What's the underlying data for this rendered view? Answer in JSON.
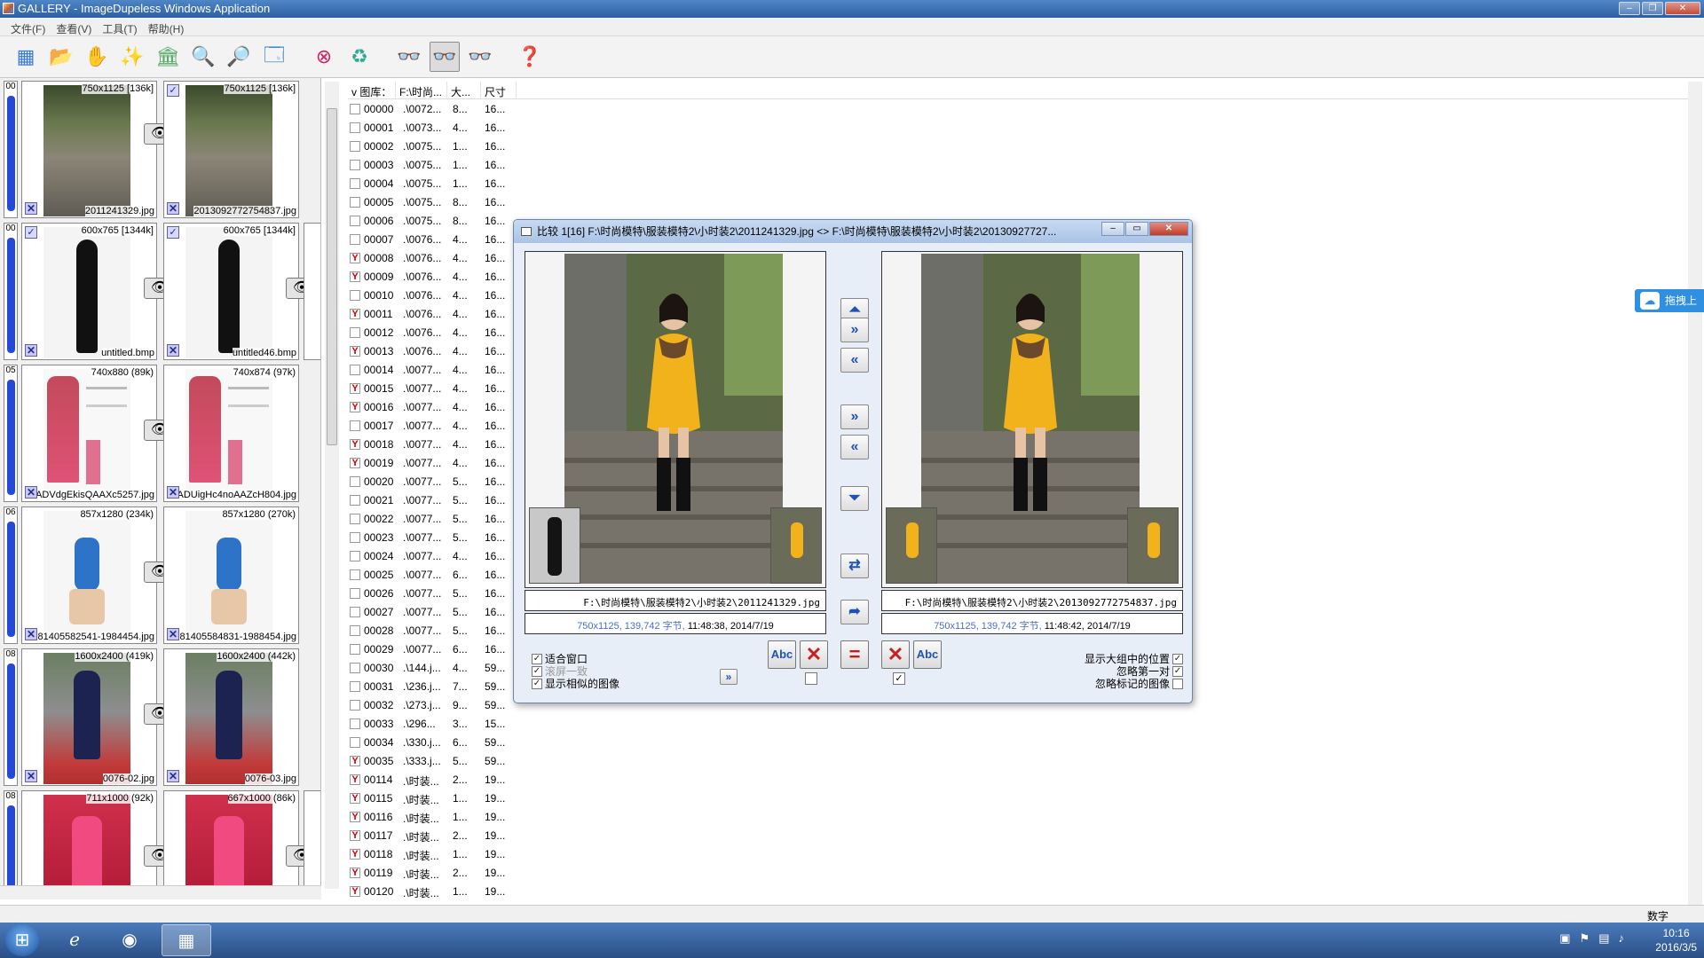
{
  "window": {
    "title": "GALLERY - ImageDupeless Windows Application"
  },
  "menu": [
    "文件(F)",
    "查看(V)",
    "工具(T)",
    "帮助(H)"
  ],
  "groups": [
    {
      "num": "00",
      "a": {
        "dim": "750x1125 [136k]",
        "name": "2011241329.jpg"
      },
      "b": {
        "dim": "750x1125 [136k]",
        "name": "2013092772754837.jpg"
      }
    },
    {
      "num": "00",
      "a": {
        "dim": "600x765 [1344k]",
        "name": "untitled.bmp"
      },
      "b": {
        "dim": "600x765 [1344k]",
        "name": "untitled46.bmp"
      }
    },
    {
      "num": "05",
      "a": {
        "dim": "740x880 (89k)",
        "name": "xADVdgEkisQAAXc5257.jpg"
      },
      "b": {
        "dim": "740x874 (97k)",
        "name": "ADUigHc4noAAZcH804.jpg"
      }
    },
    {
      "num": "06",
      "a": {
        "dim": "857x1280 (234k)",
        "name": "7181405582541-1984454.jpg"
      },
      "b": {
        "dim": "857x1280 (270k)",
        "name": "181405584831-1988454.jpg"
      }
    },
    {
      "num": "08",
      "a": {
        "dim": "1600x2400 (419k)",
        "name": "0076-02.jpg"
      },
      "b": {
        "dim": "1600x2400 (442k)",
        "name": "0076-03.jpg"
      }
    },
    {
      "num": "08",
      "a": {
        "dim": "711x1000 (92k)",
        "name": ""
      },
      "b": {
        "dim": "667x1000 (86k)",
        "name": ""
      }
    }
  ],
  "list": {
    "headers": [
      "图库：",
      "F:\\时尚...",
      "大...",
      "尺寸"
    ],
    "rows": [
      {
        "id": "00000",
        "path": ".\\0072...",
        "size": "8...",
        "dim": "16...",
        "checked": false
      },
      {
        "id": "00001",
        "path": ".\\0073...",
        "size": "4...",
        "dim": "16...",
        "checked": false
      },
      {
        "id": "00002",
        "path": ".\\0075...",
        "size": "1...",
        "dim": "16...",
        "checked": false
      },
      {
        "id": "00003",
        "path": ".\\0075...",
        "size": "1...",
        "dim": "16...",
        "checked": false
      },
      {
        "id": "00004",
        "path": ".\\0075...",
        "size": "1...",
        "dim": "16...",
        "checked": false
      },
      {
        "id": "00005",
        "path": ".\\0075...",
        "size": "8...",
        "dim": "16...",
        "checked": false
      },
      {
        "id": "00006",
        "path": ".\\0075...",
        "size": "8...",
        "dim": "16...",
        "checked": false
      },
      {
        "id": "00007",
        "path": ".\\0076...",
        "size": "4...",
        "dim": "16...",
        "checked": false
      },
      {
        "id": "00008",
        "path": ".\\0076...",
        "size": "4...",
        "dim": "16...",
        "checked": true
      },
      {
        "id": "00009",
        "path": ".\\0076...",
        "size": "4...",
        "dim": "16...",
        "checked": true
      },
      {
        "id": "00010",
        "path": ".\\0076...",
        "size": "4...",
        "dim": "16...",
        "checked": false
      },
      {
        "id": "00011",
        "path": ".\\0076...",
        "size": "4...",
        "dim": "16...",
        "checked": true
      },
      {
        "id": "00012",
        "path": ".\\0076...",
        "size": "4...",
        "dim": "16...",
        "checked": false
      },
      {
        "id": "00013",
        "path": ".\\0076...",
        "size": "4...",
        "dim": "16...",
        "checked": true
      },
      {
        "id": "00014",
        "path": ".\\0077...",
        "size": "4...",
        "dim": "16...",
        "checked": false
      },
      {
        "id": "00015",
        "path": ".\\0077...",
        "size": "4...",
        "dim": "16...",
        "checked": true
      },
      {
        "id": "00016",
        "path": ".\\0077...",
        "size": "4...",
        "dim": "16...",
        "checked": true
      },
      {
        "id": "00017",
        "path": ".\\0077...",
        "size": "4...",
        "dim": "16...",
        "checked": false
      },
      {
        "id": "00018",
        "path": ".\\0077...",
        "size": "4...",
        "dim": "16...",
        "checked": true
      },
      {
        "id": "00019",
        "path": ".\\0077...",
        "size": "4...",
        "dim": "16...",
        "checked": true
      },
      {
        "id": "00020",
        "path": ".\\0077...",
        "size": "5...",
        "dim": "16...",
        "checked": false
      },
      {
        "id": "00021",
        "path": ".\\0077...",
        "size": "5...",
        "dim": "16...",
        "checked": false
      },
      {
        "id": "00022",
        "path": ".\\0077...",
        "size": "5...",
        "dim": "16...",
        "checked": false
      },
      {
        "id": "00023",
        "path": ".\\0077...",
        "size": "5...",
        "dim": "16...",
        "checked": false
      },
      {
        "id": "00024",
        "path": ".\\0077...",
        "size": "4...",
        "dim": "16...",
        "checked": false
      },
      {
        "id": "00025",
        "path": ".\\0077...",
        "size": "6...",
        "dim": "16...",
        "checked": false
      },
      {
        "id": "00026",
        "path": ".\\0077...",
        "size": "5...",
        "dim": "16...",
        "checked": false
      },
      {
        "id": "00027",
        "path": ".\\0077...",
        "size": "5...",
        "dim": "16...",
        "checked": false
      },
      {
        "id": "00028",
        "path": ".\\0077...",
        "size": "5...",
        "dim": "16...",
        "checked": false
      },
      {
        "id": "00029",
        "path": ".\\0077...",
        "size": "6...",
        "dim": "16...",
        "checked": false
      },
      {
        "id": "00030",
        "path": ".\\144.j...",
        "size": "4...",
        "dim": "59...",
        "checked": false
      },
      {
        "id": "00031",
        "path": ".\\236.j...",
        "size": "7...",
        "dim": "59...",
        "checked": false
      },
      {
        "id": "00032",
        "path": ".\\273.j...",
        "size": "9...",
        "dim": "59...",
        "checked": false
      },
      {
        "id": "00033",
        "path": ".\\296...",
        "size": "3...",
        "dim": "15...",
        "checked": false
      },
      {
        "id": "00034",
        "path": ".\\330.j...",
        "size": "6...",
        "dim": "59...",
        "checked": false
      },
      {
        "id": "00035",
        "path": ".\\333.j...",
        "size": "5...",
        "dim": "59...",
        "checked": true
      },
      {
        "id": "00114",
        "path": ".\\时装...",
        "size": "2...",
        "dim": "19...",
        "checked": true
      },
      {
        "id": "00115",
        "path": ".\\时装...",
        "size": "1...",
        "dim": "19...",
        "checked": true
      },
      {
        "id": "00116",
        "path": ".\\时装...",
        "size": "1...",
        "dim": "19...",
        "checked": true
      },
      {
        "id": "00117",
        "path": ".\\时装...",
        "size": "2...",
        "dim": "19...",
        "checked": true
      },
      {
        "id": "00118",
        "path": ".\\时装...",
        "size": "1...",
        "dim": "19...",
        "checked": true
      },
      {
        "id": "00119",
        "path": ".\\时装...",
        "size": "2...",
        "dim": "19...",
        "checked": true
      },
      {
        "id": "00120",
        "path": ".\\时装...",
        "size": "1...",
        "dim": "19...",
        "checked": true
      }
    ]
  },
  "dialog": {
    "title": "比较 1[16] F:\\时尚模特\\服装模特2\\小时装2\\2011241329.jpg <> F:\\时尚模特\\服装模特2\\小时装2\\20130927727...",
    "left_path": "F:\\时尚模特\\服装模特2\\小时装2\\2011241329.jpg",
    "right_path": "F:\\时尚模特\\服装模特2\\小时装2\\2013092772754837.jpg",
    "left_info_dim": "750x1125, 139,742 字节, ",
    "left_info_time": "11:48:38, 2014/7/19",
    "right_info_dim": "750x1125, 139,742 字节, ",
    "right_info_time": "11:48:42, 2014/7/19",
    "opt_fit": "适合窗口",
    "opt_scroll": "滚屏一致",
    "opt_similar": "显示相似的图像",
    "opt_pos": "显示大组中的位置",
    "opt_ignore_first": "忽略第一对",
    "opt_ignore_marked": "忽略标记的图像",
    "abc": "Abc"
  },
  "floatbtn": "拖拽上",
  "status": {
    "mode": "数字"
  },
  "taskbar": {
    "time": "10:16",
    "date": "2016/3/5"
  },
  "colors": {
    "accent": "#2448d8",
    "check_red": "#cc0000",
    "title_blue": "#2b5fa3"
  }
}
